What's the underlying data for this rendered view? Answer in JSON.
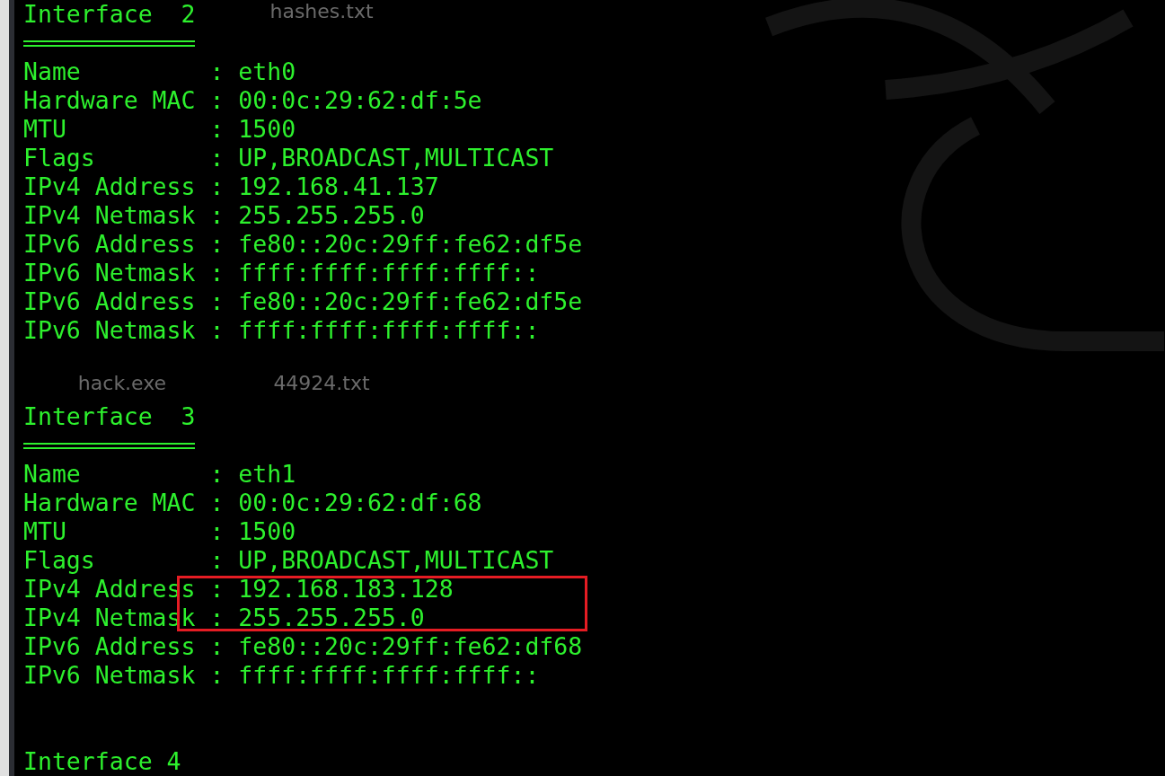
{
  "desktop": {
    "icon_labels": [
      {
        "text": "hashes.txt"
      },
      {
        "text": "hack.exe"
      },
      {
        "text": "44924.txt"
      }
    ]
  },
  "terminal": {
    "separator": ":",
    "interfaces": [
      {
        "heading": "Interface  2",
        "fields": [
          {
            "key": "Name",
            "value": "eth0"
          },
          {
            "key": "Hardware MAC",
            "value": "00:0c:29:62:df:5e"
          },
          {
            "key": "MTU",
            "value": "1500"
          },
          {
            "key": "Flags",
            "value": "UP,BROADCAST,MULTICAST"
          },
          {
            "key": "IPv4 Address",
            "value": "192.168.41.137"
          },
          {
            "key": "IPv4 Netmask",
            "value": "255.255.255.0"
          },
          {
            "key": "IPv6 Address",
            "value": "fe80::20c:29ff:fe62:df5e"
          },
          {
            "key": "IPv6 Netmask",
            "value": "ffff:ffff:ffff:ffff::"
          },
          {
            "key": "IPv6 Address",
            "value": "fe80::20c:29ff:fe62:df5e"
          },
          {
            "key": "IPv6 Netmask",
            "value": "ffff:ffff:ffff:ffff::"
          }
        ]
      },
      {
        "heading": "Interface  3",
        "fields": [
          {
            "key": "Name",
            "value": "eth1"
          },
          {
            "key": "Hardware MAC",
            "value": "00:0c:29:62:df:68"
          },
          {
            "key": "MTU",
            "value": "1500"
          },
          {
            "key": "Flags",
            "value": "UP,BROADCAST,MULTICAST"
          },
          {
            "key": "IPv4 Address",
            "value": "192.168.183.128",
            "highlighted": true
          },
          {
            "key": "IPv4 Netmask",
            "value": "255.255.255.0",
            "highlighted": true
          },
          {
            "key": "IPv6 Address",
            "value": "fe80::20c:29ff:fe62:df68"
          },
          {
            "key": "IPv6 Netmask",
            "value": "ffff:ffff:ffff:ffff::"
          }
        ]
      },
      {
        "heading": "Interface 4"
      }
    ]
  }
}
